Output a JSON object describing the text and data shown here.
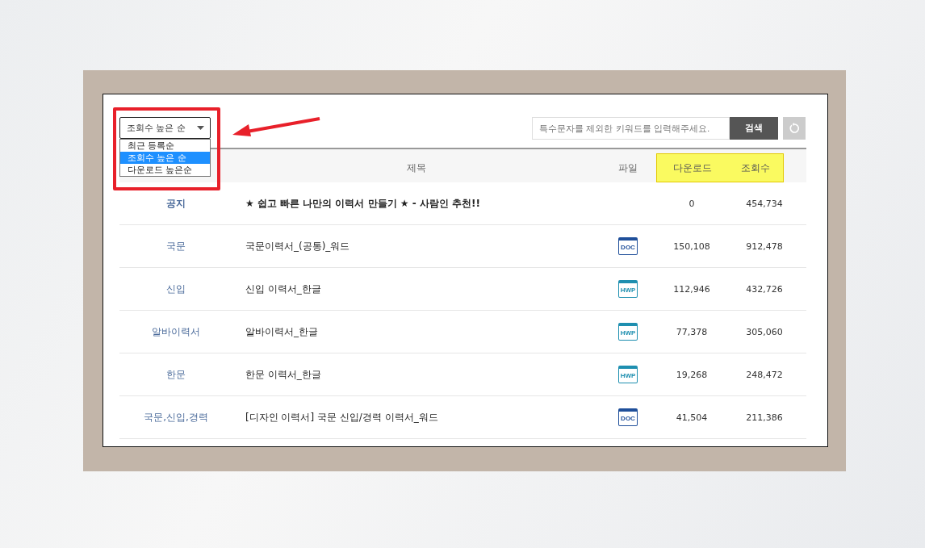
{
  "sort": {
    "value": "조회수 높은 순",
    "expanded": true,
    "options": [
      {
        "label": "최근 등록순",
        "selected": false
      },
      {
        "label": "조회수 높은 순",
        "selected": true
      },
      {
        "label": "다운로드 높은순",
        "selected": false
      }
    ]
  },
  "search": {
    "placeholder": "특수문자를 제외한 키워드를 입력해주세요.",
    "button": "검색"
  },
  "table": {
    "columns": [
      {
        "label": "제목",
        "highlighted": false
      },
      {
        "label": "파일",
        "highlighted": false
      },
      {
        "label": "다운로드",
        "highlighted": true
      },
      {
        "label": "조회수",
        "highlighted": true
      }
    ],
    "rows": [
      {
        "category": "공지",
        "title": "★ 쉽고 빠른 나만의 이력서 만들기 ★ - 사람인 추천!!",
        "notice": true,
        "downloads": "0",
        "views": "454,734"
      },
      {
        "category": "국문",
        "title": "국문이력서_(공통)_워드",
        "notice": false,
        "file": {
          "kind": "doc",
          "label": "DOC"
        },
        "downloads": "150,108",
        "views": "912,478"
      },
      {
        "category": "신입",
        "title": "신입 이력서_한글",
        "notice": false,
        "file": {
          "kind": "hwp",
          "label": "HWP"
        },
        "downloads": "112,946",
        "views": "432,726"
      },
      {
        "category": "알바이력서",
        "title": "알바이력서_한글",
        "notice": false,
        "file": {
          "kind": "hwp",
          "label": "HWP"
        },
        "downloads": "77,378",
        "views": "305,060"
      },
      {
        "category": "한문",
        "title": "한문 이력서_한글",
        "notice": false,
        "file": {
          "kind": "hwp",
          "label": "HWP"
        },
        "downloads": "19,268",
        "views": "248,472"
      },
      {
        "category": "국문,신입,경력",
        "title": "[디자인 이력서] 국문 신입/경력 이력서_워드",
        "notice": false,
        "file": {
          "kind": "doc",
          "label": "DOC"
        },
        "downloads": "41,504",
        "views": "211,386"
      }
    ]
  }
}
